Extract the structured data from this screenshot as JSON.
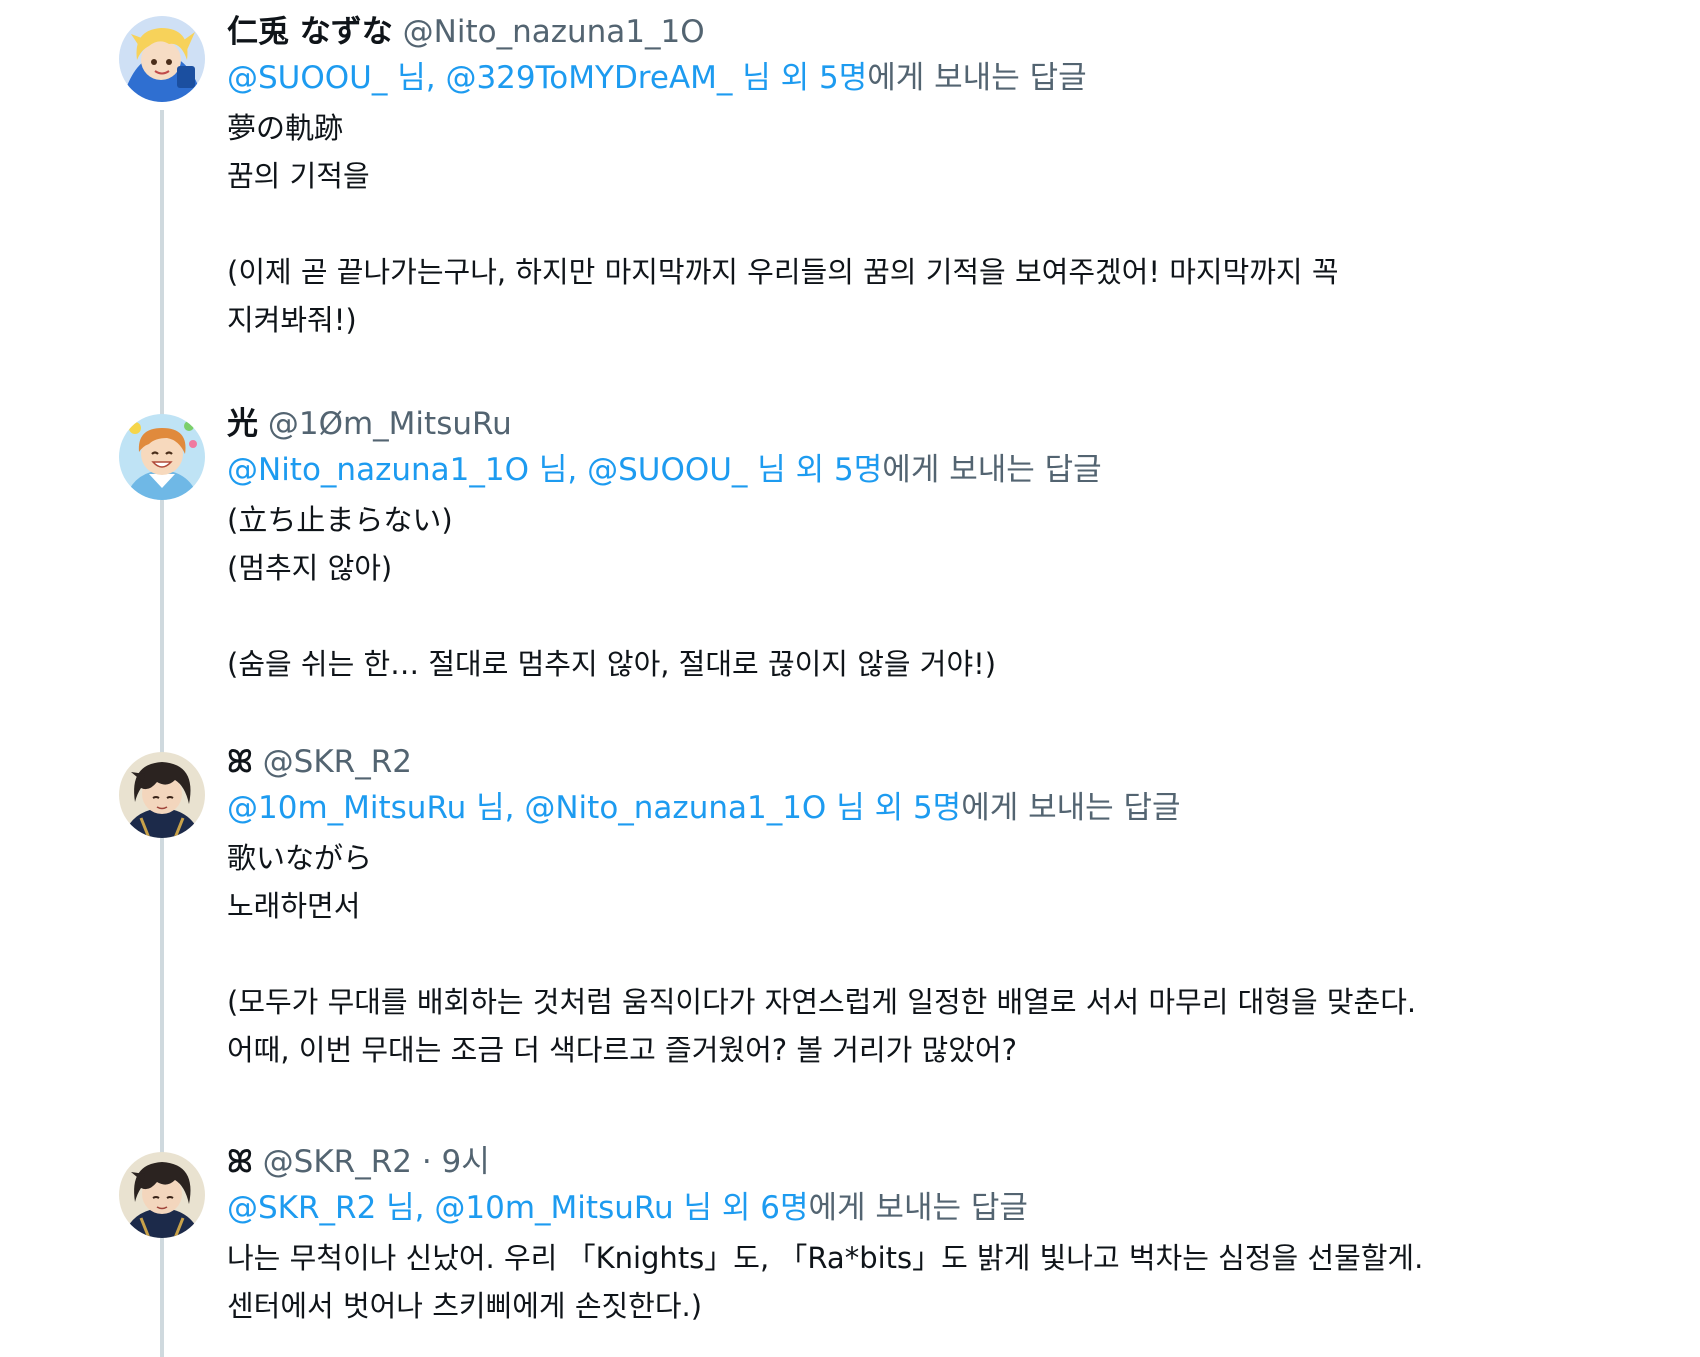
{
  "tweets": [
    {
      "display_name": "仁兎 なずな",
      "handle": "@Nito_nazuna1_1O",
      "time": "",
      "reply": {
        "mention1": "@SUOOU_",
        "sep1": " 님, ",
        "mention2": "@329ToMYDreAM_",
        "others": " 님 외 5명",
        "suffix": "에게 보내는 답글"
      },
      "lines": [
        "夢の軌跡",
        "꿈의 기적을",
        "",
        "(이제 곧 끝나가는구나, 하지만 마지막까지 우리들의 꿈의 기적을 보여주겠어! 마지막까지 꼭",
        "지켜봐줘!)"
      ],
      "avatar_icon": "blonde-character-avatar",
      "avatar_colors": [
        "#2f6fd1",
        "#f7d25a"
      ]
    },
    {
      "display_name": "光",
      "handle": "@1Øm_MitsuRu",
      "time": "",
      "reply": {
        "mention1": "@Nito_nazuna1_1O",
        "sep1": " 님, ",
        "mention2": "@SUOOU_",
        "others": " 님 외 5명",
        "suffix": "에게 보내는 답글"
      },
      "lines": [
        "(立ち止まらない)",
        "(멈추지 않아)",
        "",
        "(숨을 쉬는 한… 절대로 멈추지 않아, 절대로 끊이지 않을 거야!)"
      ],
      "avatar_icon": "orange-hair-character-avatar",
      "avatar_colors": [
        "#6fb8e6",
        "#e08a3c"
      ]
    },
    {
      "display_name": "ꕤ",
      "handle": "@SKR_R2",
      "time": "",
      "reply": {
        "mention1": "@10m_MitsuRu",
        "sep1": " 님, ",
        "mention2": "@Nito_nazuna1_1O",
        "others": " 님 외 5명",
        "suffix": "에게 보내는 답글"
      },
      "lines": [
        "歌いながら",
        "노래하면서",
        "",
        "(모두가 무대를 배회하는 것처럼 움직이다가 자연스럽게 일정한 배열로 서서 마무리 대형을 맞춘다.",
        "어때, 이번 무대는 조금 더 색다르고 즐거웠어? 볼 거리가 많았어?"
      ],
      "avatar_icon": "dark-hair-character-avatar",
      "avatar_colors": [
        "#2b2320",
        "#c9a24a"
      ]
    },
    {
      "display_name": "ꕤ",
      "handle": "@SKR_R2",
      "time": " · 9시",
      "reply": {
        "mention1": "@SKR_R2",
        "sep1": " 님, ",
        "mention2": "@10m_MitsuRu",
        "others": " 님 외 6명",
        "suffix": "에게 보내는 답글"
      },
      "lines": [
        "나는 무척이나 신났어. 우리 「Knights」도, 「Ra*bits」도 밝게 빛나고 벅차는 심정을 선물할게.",
        "센터에서 벗어나 츠키삐에게 손짓한다.)"
      ],
      "avatar_icon": "dark-hair-character-avatar",
      "avatar_colors": [
        "#2b2320",
        "#c9a24a"
      ]
    }
  ],
  "colors": {
    "link": "#1d9bf0",
    "secondary_text": "#536471",
    "primary_text": "#0f1419",
    "thread_line": "#cfd9de"
  }
}
